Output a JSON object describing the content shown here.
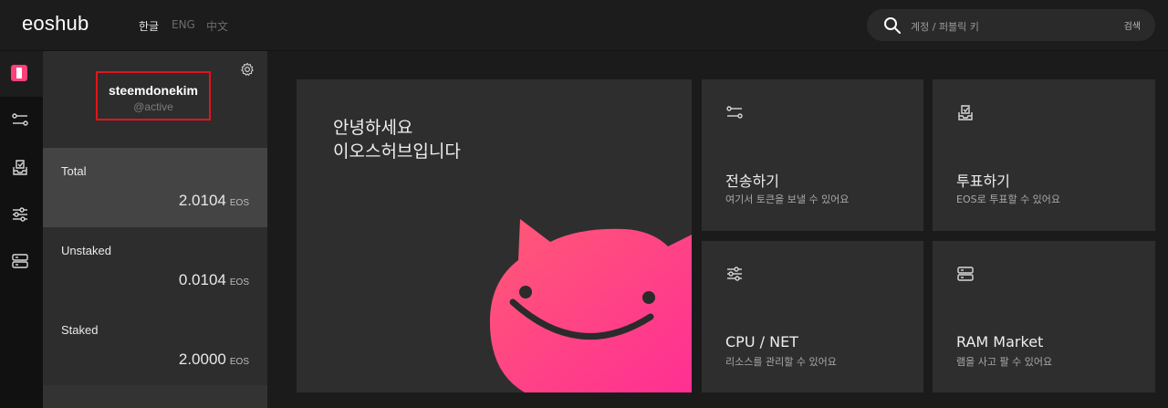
{
  "brand": {
    "logo": "eoshub"
  },
  "languages": [
    "한글",
    "ENG",
    "中文"
  ],
  "search": {
    "placeholder": "계정 / 퍼블릭 키",
    "button": "검색"
  },
  "account": {
    "name": "steemdonekim",
    "permission": "@active"
  },
  "balances": [
    {
      "label": "Total",
      "amount": "2.0104",
      "unit": "EOS"
    },
    {
      "label": "Unstaked",
      "amount": "0.0104",
      "unit": "EOS"
    },
    {
      "label": "Staked",
      "amount": "2.0000",
      "unit": "EOS"
    }
  ],
  "welcome": {
    "title": "안녕하세요\n이오스허브입니다"
  },
  "cards": [
    {
      "title": "전송하기",
      "desc": "여기서 토큰을 보낼 수 있어요",
      "icon": "transfer-icon"
    },
    {
      "title": "투표하기",
      "desc": "EOS로 투표할 수 있어요",
      "icon": "vote-icon"
    },
    {
      "title": "CPU / NET",
      "desc": "리소스를 관리할 수 있어요",
      "icon": "sliders-icon"
    },
    {
      "title": "RAM Market",
      "desc": "램을 사고 팔 수 있어요",
      "icon": "server-icon"
    }
  ],
  "colors": {
    "accent": "#ff3f7a",
    "highlight_box": "#e3131c",
    "background": "#1b1b1b",
    "card": "#2e2e2e"
  }
}
